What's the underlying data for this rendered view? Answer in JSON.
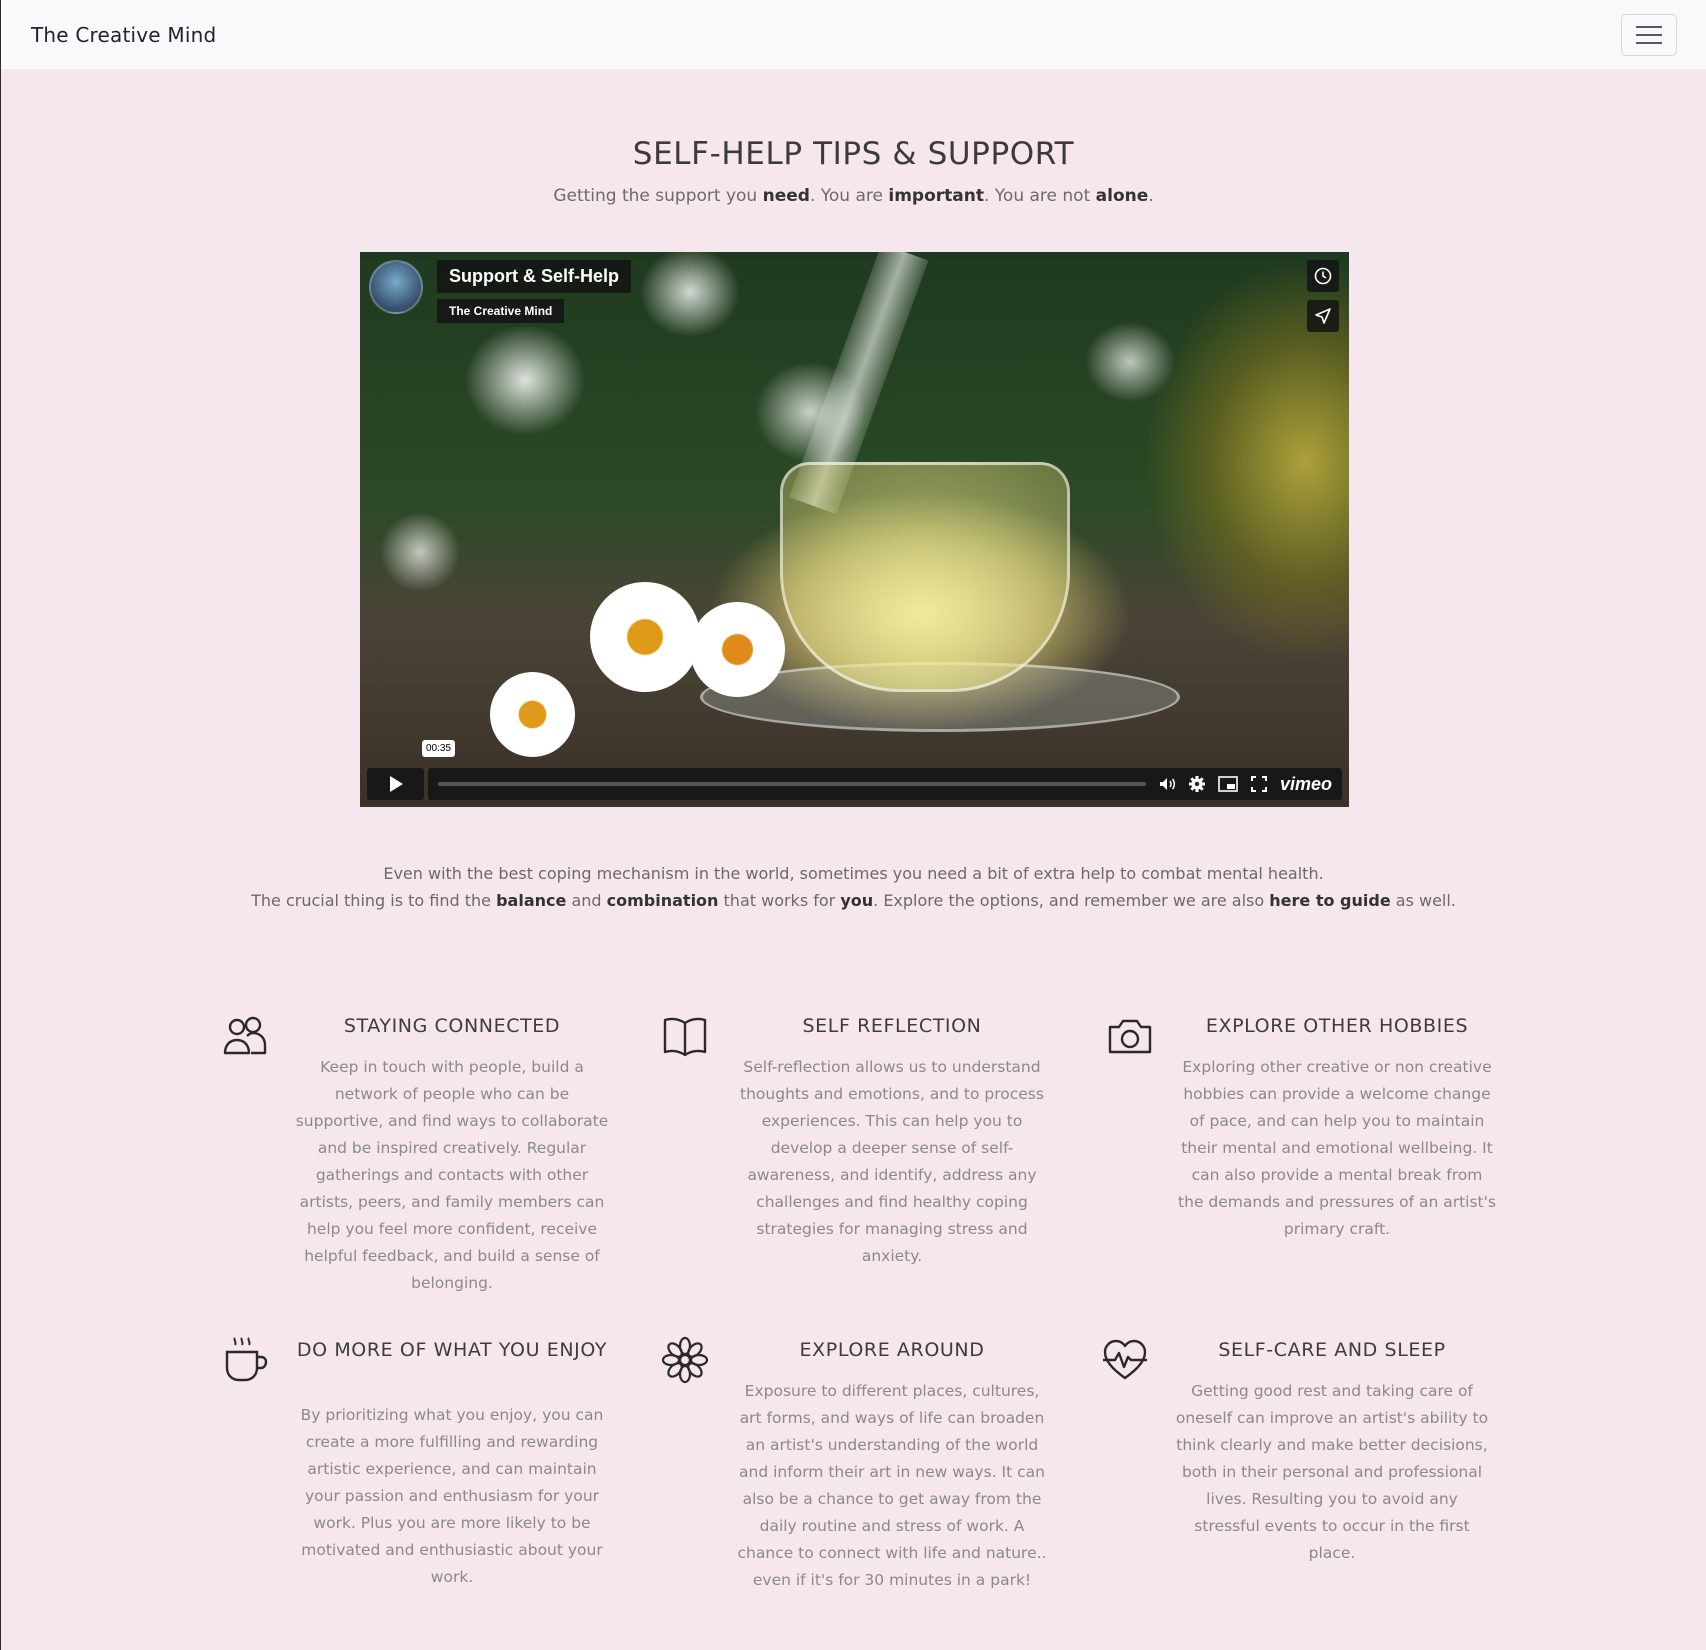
{
  "navbar": {
    "brand": "The Creative Mind",
    "menu_icon": "hamburger-menu-icon"
  },
  "hero": {
    "title": "SELF-HELP TIPS & SUPPORT",
    "subtitle": {
      "p1": "Getting the support you ",
      "b1": "need",
      "p2": ". You are ",
      "b2": "important",
      "p3": ". You are not ",
      "b3": "alone",
      "p4": "."
    }
  },
  "video": {
    "title": "Support & Self-Help",
    "channel": "The Creative Mind",
    "time_tooltip": "00:35",
    "progress": 0.0,
    "provider_logo": "vimeo",
    "icons": [
      "clock-icon",
      "send-icon",
      "play-icon",
      "volume-icon",
      "settings-icon",
      "pip-icon",
      "fullscreen-icon"
    ]
  },
  "intro": {
    "line1": "Even with the best coping mechanism in the world, sometimes you need a bit of extra help to combat mental health.",
    "l2_p1": "The crucial thing is to find the ",
    "l2_b1": "balance",
    "l2_p2": " and ",
    "l2_b2": "combination",
    "l2_p3": " that works for ",
    "l2_b3": "you",
    "l2_p4": ". Explore the options, and remember we are also ",
    "l2_b4": "here to guide",
    "l2_p5": " as well."
  },
  "features": [
    {
      "icon": "people-icon",
      "title": "STAYING CONNECTED",
      "text": "Keep in touch with people, build a network of people who can be supportive, and find ways to collaborate and be inspired creatively. Regular gatherings and contacts with other artists, peers, and family members can help you feel more confident, receive helpful feedback, and build a sense of belonging."
    },
    {
      "icon": "book-icon",
      "title": "SELF REFLECTION",
      "text": "Self-reflection allows us to understand thoughts and emotions, and to process experiences. This can help you to develop a deeper sense of self-awareness, and identify, address any challenges and find healthy coping strategies for managing stress and anxiety."
    },
    {
      "icon": "camera-icon",
      "title": "EXPLORE OTHER HOBBIES",
      "text": "Exploring other creative or non creative hobbies can provide a welcome change of pace, and can help you to maintain their mental and emotional wellbeing. It can also provide a mental break from the demands and pressures of an artist's primary craft."
    },
    {
      "icon": "hot-cup-icon",
      "title": "DO MORE OF WHAT YOU ENJOY",
      "text": "By prioritizing what you enjoy, you can create a more fulfilling and rewarding artistic experience, and can maintain your passion and enthusiasm for your work. Plus you are more likely to be motivated and enthusiastic about your work."
    },
    {
      "icon": "flower-icon",
      "title": "EXPLORE AROUND",
      "text": "Exposure to different places, cultures, art forms, and ways of life can broaden an artist's understanding of the world and inform their art in new ways. It can also be a chance to get away from the daily routine and stress of work. A chance to connect with life and nature.. even if it's for 30 minutes in a park!"
    },
    {
      "icon": "heart-pulse-icon",
      "title": "SELF-CARE AND SLEEP",
      "text": "Getting good rest and taking care of oneself can improve an artist's ability to think clearly and make better decisions, both in their personal and professional lives. Resulting you to avoid any stressful events to occur in the first place."
    }
  ]
}
